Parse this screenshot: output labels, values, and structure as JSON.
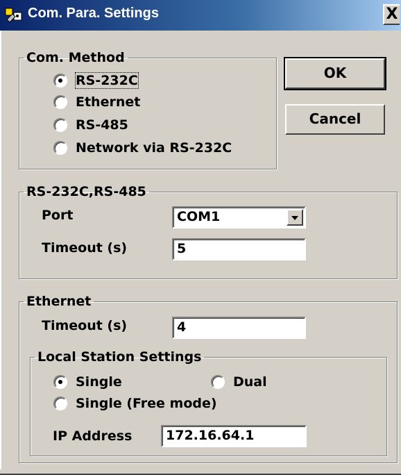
{
  "window": {
    "title": "Com. Para. Settings",
    "close_label": "X"
  },
  "com_method": {
    "legend": "Com. Method",
    "options": [
      {
        "label": "RS-232C",
        "selected": true
      },
      {
        "label": "Ethernet",
        "selected": false
      },
      {
        "label": "RS-485",
        "selected": false
      },
      {
        "label": "Network via RS-232C",
        "selected": false
      }
    ]
  },
  "buttons": {
    "ok": "OK",
    "cancel": "Cancel"
  },
  "serial": {
    "legend": "RS-232C,RS-485",
    "port_label": "Port",
    "port_value": "COM1",
    "timeout_label": "Timeout (s)",
    "timeout_value": "5"
  },
  "ethernet": {
    "legend": "Ethernet",
    "timeout_label": "Timeout (s)",
    "timeout_value": "4",
    "local_station": {
      "legend": "Local Station Settings",
      "options": [
        {
          "label": "Single",
          "selected": true
        },
        {
          "label": "Dual",
          "selected": false
        },
        {
          "label": "Single (Free mode)",
          "selected": false
        }
      ],
      "ip_label": "IP Address",
      "ip_value": "172.16.64.1"
    }
  },
  "icons": {
    "title_icon": "settings-app-icon",
    "dropdown_icon": "chevron-down-icon"
  }
}
